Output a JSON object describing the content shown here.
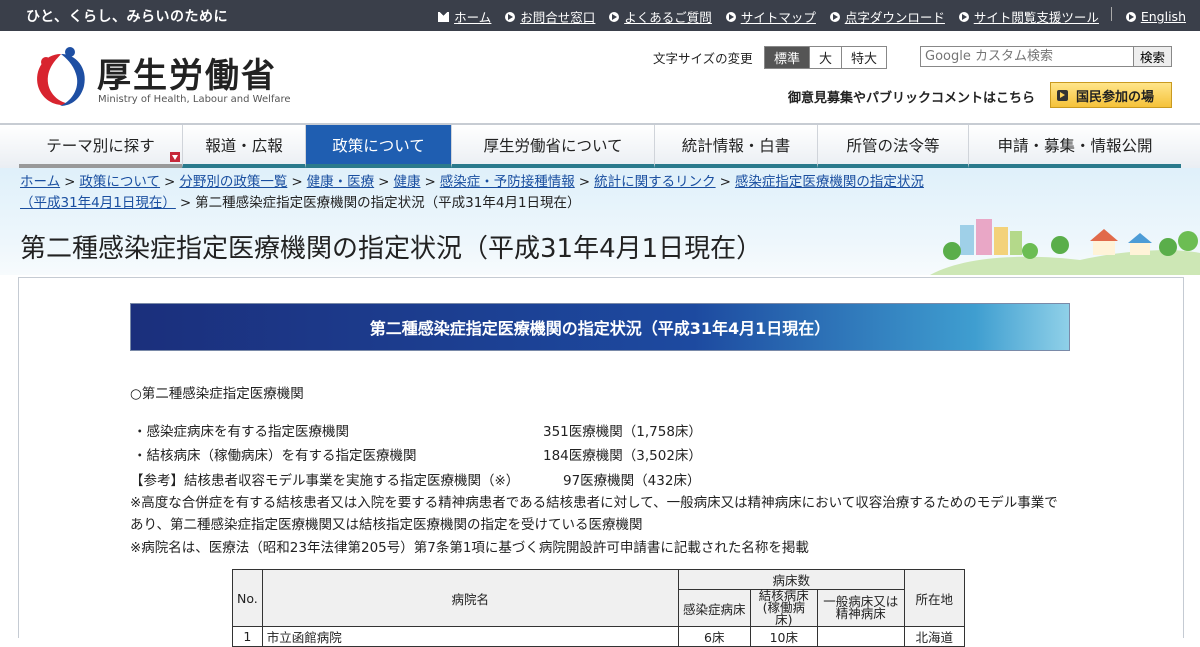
{
  "topbar": {
    "tagline": "ひと、くらし、みらいのために",
    "links": [
      "ホーム",
      "お問合せ窓口",
      "よくあるご質問",
      "サイトマップ",
      "点字ダウンロード",
      "サイト閲覧支援ツール"
    ],
    "english": "English"
  },
  "header": {
    "org_name": "厚生労働省",
    "org_name_en": "Ministry of Health, Labour and Welfare",
    "font_size_label": "文字サイズの変更",
    "font_size_options": [
      "標準",
      "大",
      "特大"
    ],
    "search_placeholder": "Google カスタム検索",
    "search_button": "検索",
    "opinion_link": "御意見募集やパブリックコメントはこちら",
    "participation_button": "国民参加の場"
  },
  "nav": {
    "items": [
      "テーマ別に探す",
      "報道・広報",
      "政策について",
      "厚生労働省について",
      "統計情報・白書",
      "所管の法令等",
      "申請・募集・情報公開"
    ],
    "active_index": 2
  },
  "breadcrumb": {
    "links": [
      "ホーム",
      "政策について",
      "分野別の政策一覧",
      "健康・医療",
      "健康",
      "感染症・予防接種情報",
      "統計に関するリンク",
      "感染症指定医療機関の指定状況",
      "（平成31年4月1日現在）"
    ],
    "current": "第二種感染症指定医療機関の指定状況（平成31年4月1日現在）"
  },
  "page": {
    "title": "第二種感染症指定医療機関の指定状況（平成31年4月1日現在）",
    "doc_heading": "第二種感染症指定医療機関の指定状況（平成31年4月1日現在）",
    "section_label": "○第二種感染症指定医療機関",
    "summary": [
      {
        "label": "・感染症病床を有する指定医療機関",
        "value": "351医療機関（1,758床）"
      },
      {
        "label": "・結核病床（稼働病床）を有する指定医療機関",
        "value": "184医療機関（3,502床）"
      },
      {
        "label": "【参考】結核患者収容モデル事業を実施する指定医療機関（※）",
        "value": "97医療機関（432床）"
      }
    ],
    "note1": "※高度な合併症を有する結核患者又は入院を要する精神病患者である結核患者に対して、一般病床又は精神病床において収容治療するためのモデル事業であり、第二種感染症指定医療機関又は結核指定医療機関の指定を受けている医療機関",
    "note2": "※病院名は、医療法（昭和23年法律第205号）第7条第1項に基づく病院開設許可申請書に記載された名称を掲載"
  },
  "table": {
    "headers": {
      "no": "No.",
      "name": "病院名",
      "beds": "病床数",
      "infection": "感染症病床",
      "tb": "結核病床\n(稼働病床)",
      "general": "一般病床又は\n精神病床",
      "location": "所在地"
    },
    "rows": [
      {
        "no": "1",
        "name": "市立函館病院",
        "infection": "6床",
        "tb": "10床",
        "general": "",
        "location": "北海道"
      }
    ]
  }
}
